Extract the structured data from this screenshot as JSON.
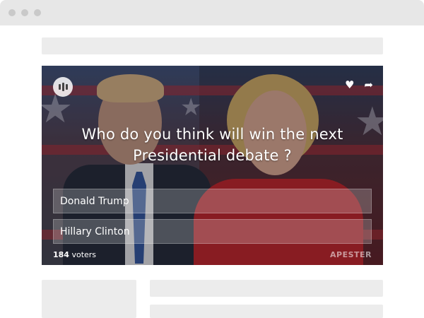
{
  "browser": {
    "window_controls": [
      "close-dot",
      "minimize-dot",
      "maximize-dot"
    ]
  },
  "poll": {
    "question": "Who do you think will win the next Presidential debate ?",
    "answers": [
      {
        "label": "Donald Trump"
      },
      {
        "label": "Hillary Clinton"
      }
    ],
    "voter_count": "184",
    "voter_label": "voters",
    "brand": "APESTER",
    "icons": {
      "badge": "apester-logo-icon",
      "like": "heart-icon",
      "share": "share-arrow-icon"
    }
  },
  "colors": {
    "browser_bar": "#e7e7e7",
    "skeleton": "#ececec",
    "answer_bg": "rgba(255,255,255,0.22)",
    "text": "#ffffff"
  }
}
